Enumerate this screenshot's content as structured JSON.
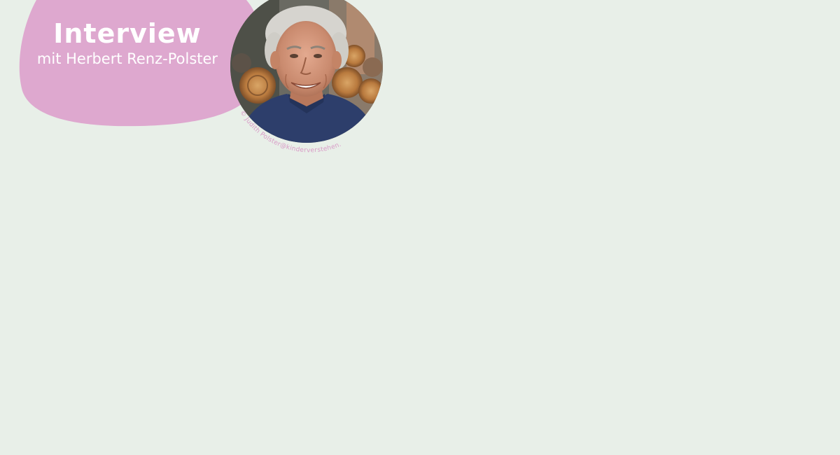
{
  "banner": {
    "title": "Interview",
    "subtitle": "mit Herbert Renz-Polster"
  },
  "photo": {
    "credit": "© Judith Polster@kinderverstehen.de",
    "subject": "portrait of a smiling grey-haired man in a navy shirt in front of stacked logs"
  },
  "colors": {
    "background": "#e8efe8",
    "blob": "#dea8cf",
    "title_text": "#ffffff",
    "credit_text": "#d89ac6",
    "shirt": "#2d3e6b"
  }
}
